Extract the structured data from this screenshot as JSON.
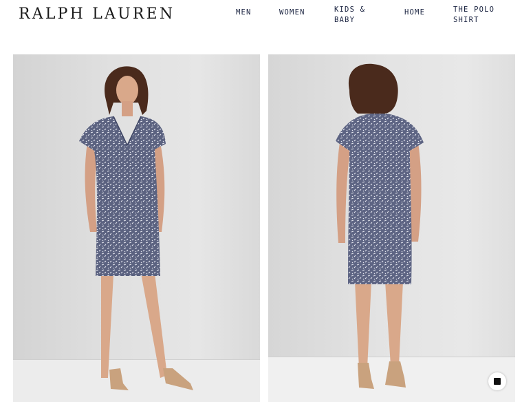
{
  "header": {
    "logo": "RALPH LAUREN",
    "nav": [
      {
        "label": "MEN"
      },
      {
        "label": "WOMEN"
      },
      {
        "label": "KIDS & BABY"
      },
      {
        "label": "HOME"
      },
      {
        "label": "THE POLO SHIRT"
      }
    ]
  },
  "gallery": {
    "images": [
      {
        "view": "front"
      },
      {
        "view": "back"
      }
    ]
  },
  "chat": {
    "icon": "chat-stop-icon"
  },
  "colors": {
    "navy": "#1a2340",
    "dress": "#5b6280",
    "dress_dark": "#3d4463",
    "hair": "#4a2a1c",
    "skin": "#d9a88a",
    "sandal": "#c9a27e"
  }
}
